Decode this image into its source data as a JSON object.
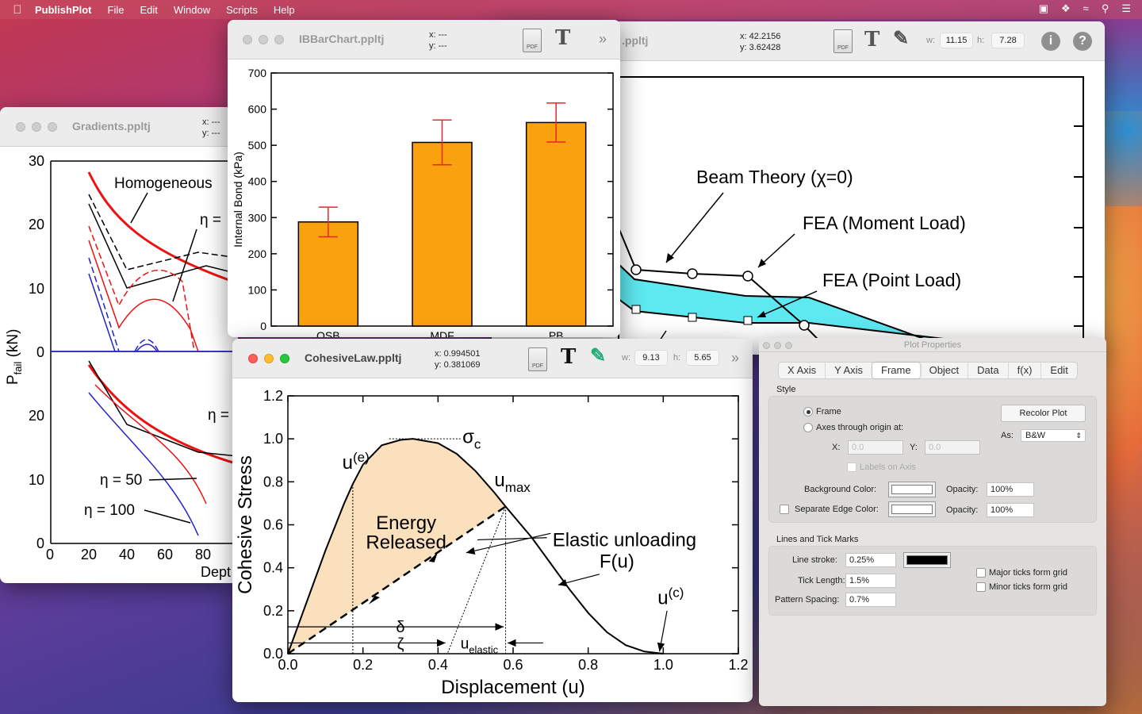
{
  "menubar": {
    "apple": "",
    "items": [
      "PublishPlot",
      "File",
      "Edit",
      "Window",
      "Scripts",
      "Help"
    ]
  },
  "beam_window": {
    "title": ".ppltj",
    "coords": {
      "x": "x: 42.2156",
      "y": "y: 3.62428"
    },
    "w_label": "w:",
    "w_value": "11.15",
    "h_label": "h:",
    "h_value": "7.28",
    "labels": {
      "beam_theory": "Beam Theory (χ=0)",
      "fea_moment": "FEA (Moment Load)",
      "fea_point": "FEA (Point Load)"
    }
  },
  "gradients_window": {
    "title": "Gradients.ppltj",
    "coords": {
      "x": "x: ---",
      "y": "y: ---"
    },
    "y_ticks_top": [
      "30",
      "20",
      "10",
      "0"
    ],
    "y_ticks_bottom": [
      "20",
      "10",
      "0"
    ],
    "x_ticks": [
      "0",
      "20",
      "40",
      "60",
      "80"
    ],
    "ylabel": "P",
    "ylabel_sub": "fail",
    "ylabel_unit": " (kN)",
    "xlabel": "Dept",
    "annotations": {
      "homogeneous": "Homogeneous",
      "eta_top": "η =",
      "eta_mid": "η =",
      "eta50": "η = 50",
      "eta100": "η = 100"
    }
  },
  "bar_window": {
    "title": "IBBarChart.ppltj",
    "coords": {
      "x": "x: ---",
      "y": "y: ---"
    }
  },
  "cohesive_window": {
    "title": "CohesiveLaw.ppltj",
    "coords": {
      "x": "x: 0.994501",
      "y": "y: 0.381069"
    },
    "w_label": "w:",
    "w_value": "9.13",
    "h_label": "h:",
    "h_value": "5.65",
    "labels": {
      "energy1": "Energy",
      "energy2": "Released",
      "elastic1": "Elastic unloading",
      "elastic2": "F(u)",
      "ue": "u",
      "ue_sup": "(e)",
      "sigma": "σ",
      "sigma_sub": "c",
      "umax": "u",
      "umax_sub": "max",
      "uc": "u",
      "uc_sup": "(c)",
      "delta": "δ",
      "zeta": "ζ",
      "uel": "u",
      "uel_sub": "elastic"
    }
  },
  "chart_data": [
    {
      "type": "bar",
      "categories": [
        "OSB",
        "MDF",
        "PB"
      ],
      "values": [
        288,
        508,
        563
      ],
      "error": [
        41,
        62,
        54
      ],
      "ylabel": "Internal Bond (kPa)",
      "xlabel": "",
      "ylim": [
        0,
        700
      ],
      "yticks": [
        0,
        100,
        200,
        300,
        400,
        500,
        600,
        700
      ],
      "colors": {
        "bar": "#f9a10f",
        "error": "#e8262a"
      }
    },
    {
      "type": "line",
      "xlabel": "Displacement (u)",
      "ylabel": "Cohesive Stress",
      "xlim": [
        0,
        1.2
      ],
      "ylim": [
        0,
        1.2
      ],
      "xticks": [
        "0.0",
        "0.2",
        "0.4",
        "0.6",
        "0.8",
        "1.0",
        "1.2"
      ],
      "yticks": [
        "0.0",
        "0.2",
        "0.4",
        "0.6",
        "0.8",
        "1.0",
        "1.2"
      ],
      "series": [
        {
          "x": [
            0,
            0.05,
            0.1,
            0.15,
            0.173,
            0.2,
            0.25,
            0.3,
            0.333,
            0.4,
            0.45,
            0.5,
            0.55,
            0.58,
            0.65,
            0.7,
            0.75,
            0.8,
            0.85,
            0.9,
            0.95,
            1.0
          ],
          "y": [
            0,
            0.24,
            0.48,
            0.7,
            0.79,
            0.88,
            0.97,
            0.995,
            1.0,
            0.98,
            0.93,
            0.85,
            0.75,
            0.685,
            0.54,
            0.42,
            0.3,
            0.19,
            0.1,
            0.04,
            0.01,
            0.0
          ]
        },
        {
          "x": [
            0,
            0.58
          ],
          "y": [
            0,
            0.685
          ]
        }
      ],
      "colors": {
        "fill": "#fbe0bd"
      }
    }
  ],
  "panel": {
    "title": "Plot Properties",
    "tabs": [
      "X Axis",
      "Y Axis",
      "Frame",
      "Object",
      "Data",
      "f(x)",
      "Edit"
    ],
    "selected_tab": "Frame",
    "style_label": "Style",
    "radio_frame": "Frame",
    "radio_axes": "Axes through origin at:",
    "x_label": "X:",
    "x_value": "0.0",
    "y_label": "Y:",
    "y_value": "0.0",
    "labels_on_axis": "Labels on Axis",
    "recolor_button": "Recolor Plot",
    "as_label": "As:",
    "as_value": "B&W",
    "bg_color_label": "Background Color:",
    "opacity_label": "Opacity:",
    "bg_opacity": "100%",
    "sep_edge_label": "Separate Edge Color:",
    "edge_opacity": "100%",
    "lines_label": "Lines and Tick Marks",
    "line_stroke_label": "Line stroke:",
    "line_stroke_value": "0.25%",
    "tick_length_label": "Tick Length:",
    "tick_length_value": "1.5%",
    "pattern_label": "Pattern Spacing:",
    "pattern_value": "0.7%",
    "major_grid": "Major ticks form grid",
    "minor_grid": "Minor ticks form grid"
  }
}
